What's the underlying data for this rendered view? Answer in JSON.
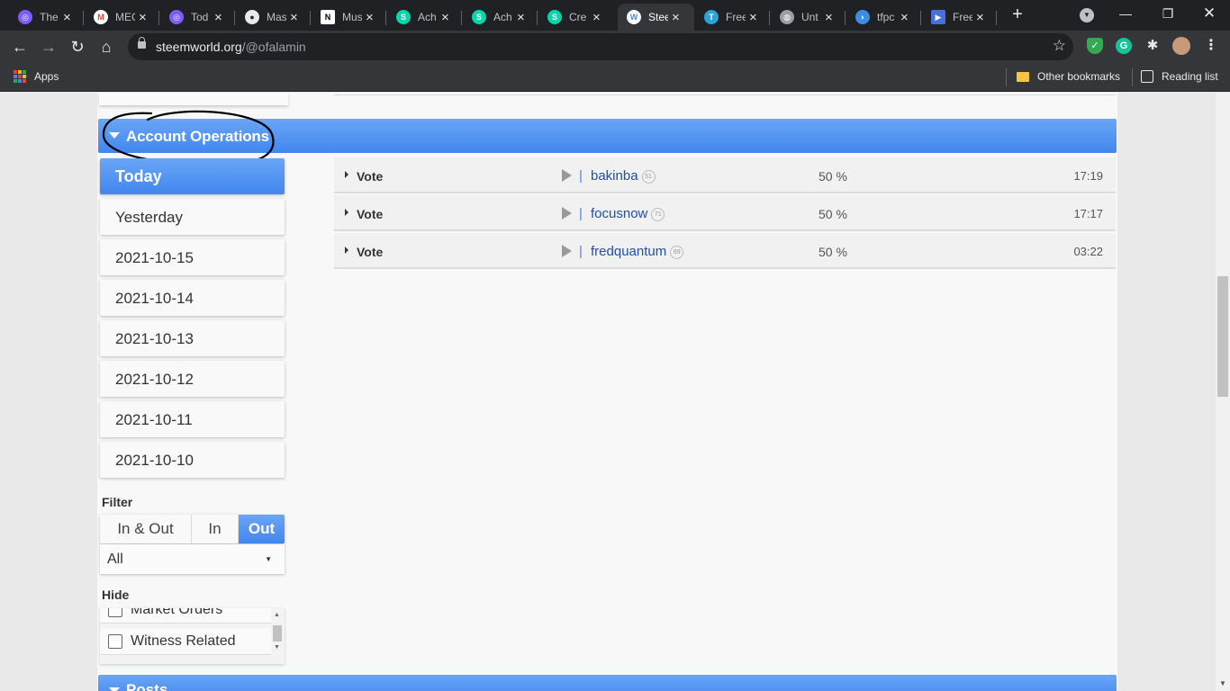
{
  "browser": {
    "tabs": [
      {
        "title": "The",
        "icon": "pages-icon",
        "color": "#7c5cfc"
      },
      {
        "title": "MEC",
        "icon": "gmail-icon",
        "color": "#ea4335"
      },
      {
        "title": "Tod",
        "icon": "pages-icon",
        "color": "#7c5cfc"
      },
      {
        "title": "Mas",
        "icon": "github-icon",
        "color": "#24292e"
      },
      {
        "title": "Mus",
        "icon": "notion-icon",
        "color": "#ffffff"
      },
      {
        "title": "Ach",
        "icon": "steemit-icon",
        "color": "#06d6a9"
      },
      {
        "title": "Ach",
        "icon": "steemit-icon",
        "color": "#06d6a9"
      },
      {
        "title": "Cre",
        "icon": "steemit-icon",
        "color": "#06d6a9"
      },
      {
        "title": "Stee",
        "icon": "steemworld-icon",
        "color": "#4a90e2",
        "active": true
      },
      {
        "title": "Free",
        "icon": "tab-t-icon",
        "color": "#2aa3d6"
      },
      {
        "title": "Unt",
        "icon": "globe-icon",
        "color": "#9aa0a6"
      },
      {
        "title": "tfpc",
        "icon": "cloud-icon",
        "color": "#3d8de0"
      },
      {
        "title": "Free",
        "icon": "video-icon",
        "color": "#4a6fd8"
      }
    ],
    "url_host": "steemworld.org",
    "url_path": "/@ofalamin",
    "bookmarks": {
      "apps": "Apps",
      "other": "Other bookmarks",
      "reading": "Reading list"
    }
  },
  "section": {
    "title": "Account Operations"
  },
  "days": [
    "Today",
    "Yesterday",
    "2021-10-15",
    "2021-10-14",
    "2021-10-13",
    "2021-10-12",
    "2021-10-11",
    "2021-10-10"
  ],
  "filter": {
    "label": "Filter",
    "options": [
      "In & Out",
      "In",
      "Out"
    ],
    "active": "Out",
    "select_value": "All"
  },
  "hide": {
    "label": "Hide",
    "items": [
      "Market Orders",
      "Witness Related"
    ]
  },
  "operations": [
    {
      "type": "Vote",
      "user": "bakinba",
      "rep": "51",
      "percent": "50 %",
      "time": "17:19"
    },
    {
      "type": "Vote",
      "user": "focusnow",
      "rep": "71",
      "percent": "50 %",
      "time": "17:17"
    },
    {
      "type": "Vote",
      "user": "fredquantum",
      "rep": "69",
      "percent": "50 %",
      "time": "03:22"
    }
  ],
  "next_section": {
    "title": "Posts"
  },
  "colors": {
    "accent": "#4286ee",
    "link": "#1f4fa6"
  }
}
